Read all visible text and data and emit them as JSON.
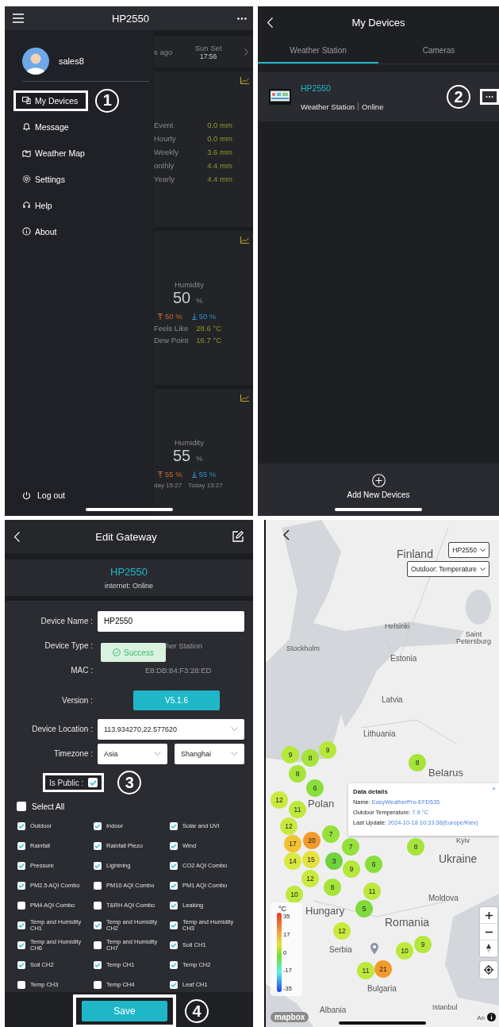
{
  "drawer_screen": {
    "title": "HP2550",
    "user": {
      "name": "sales8"
    },
    "menu": [
      {
        "label": "My Devices",
        "highlighted": true,
        "callout": "1"
      },
      {
        "label": "Message",
        "highlighted": false
      },
      {
        "label": "Weather Map",
        "highlighted": false
      },
      {
        "label": "Settings",
        "highlighted": false
      },
      {
        "label": "Help",
        "highlighted": false
      },
      {
        "label": "About",
        "highlighted": false
      }
    ],
    "logout": "Log out",
    "background": {
      "updated": "s ago",
      "sunset_label": "Sun Set",
      "sunset_time": "17:56",
      "rain": [
        {
          "label": "Event",
          "value": "0.0 mm"
        },
        {
          "label": "Hourly",
          "value": "0.0 mm"
        },
        {
          "label": "Weekly",
          "value": "3.6 mm"
        },
        {
          "label": "onthly",
          "value": "4.4 mm"
        },
        {
          "label": "Yearly",
          "value": "4.4 mm"
        }
      ],
      "humidity_cards": [
        {
          "label": "Humidity",
          "value": "50",
          "unit": "%",
          "high": "50 %",
          "low": "50 %",
          "extras": [
            {
              "label": "Feels Like",
              "value": "28.6 °C"
            },
            {
              "label": "Dew Point",
              "value": "16.7 °C"
            }
          ]
        },
        {
          "label": "Humidity",
          "value": "55",
          "unit": "%",
          "high": "55 %",
          "low": "55 %",
          "times": [
            "day 15:27",
            "Today 15:27"
          ]
        }
      ]
    }
  },
  "devices_screen": {
    "title": "My Devices",
    "tabs": [
      {
        "label": "Weather Station",
        "selected": true
      },
      {
        "label": "Cameras",
        "selected": false
      }
    ],
    "devices": [
      {
        "name": "HP2550",
        "type": "Weather Station",
        "status": "Online",
        "callout": "2"
      }
    ],
    "add_button": "Add New Devices"
  },
  "edit_screen": {
    "title": "Edit Gateway",
    "device": "HP2550",
    "internet": "internet: Online",
    "fields": [
      {
        "kind": "input",
        "label": "Device Name :",
        "value": "HP2550"
      },
      {
        "kind": "text",
        "label": "Device Type :",
        "value": "her Station",
        "toast": "Success"
      },
      {
        "kind": "text",
        "label": "MAC :",
        "value": "E8:DB:84:F3:28:ED"
      },
      {
        "kind": "button",
        "label": "Version :",
        "value": "V5.1.6"
      },
      {
        "kind": "select",
        "label": "Device Location :",
        "value": "113.934270,22.577620"
      },
      {
        "kind": "select_pair",
        "label": "Timezone :",
        "values": [
          "Asia",
          "Shanghai"
        ]
      }
    ],
    "is_public": {
      "label": "Is Public :",
      "checked": true,
      "callout": "3"
    },
    "select_all": {
      "label": "Select All",
      "checked": false
    },
    "sensors": [
      {
        "label": "Outdoor",
        "checked": true
      },
      {
        "label": "Indoor",
        "checked": true
      },
      {
        "label": "Solar and UVI",
        "checked": true
      },
      {
        "label": "Rainfall",
        "checked": true
      },
      {
        "label": "Rainfall Piezo",
        "checked": true
      },
      {
        "label": "Wind",
        "checked": true
      },
      {
        "label": "Pressure",
        "checked": true
      },
      {
        "label": "Lightning",
        "checked": true
      },
      {
        "label": "CO2 AQI Combo",
        "checked": true
      },
      {
        "label": "PM2.5 AQI Combo",
        "checked": true
      },
      {
        "label": "PM10 AQI Combo",
        "checked": false
      },
      {
        "label": "PM1 AQI Combo",
        "checked": true
      },
      {
        "label": "PM4 AQI Combo",
        "checked": false
      },
      {
        "label": "T&RH AQI Combo",
        "checked": false
      },
      {
        "label": "Leaking",
        "checked": true
      },
      {
        "label": "Temp and Humidity CH1",
        "checked": true
      },
      {
        "label": "Temp and Humidity CH2",
        "checked": true
      },
      {
        "label": "Temp and Humidity CH3",
        "checked": true
      },
      {
        "label": "Temp and Humidity CH6",
        "checked": true
      },
      {
        "label": "Temp and Humidity CH7",
        "checked": false
      },
      {
        "label": "Soil CH1",
        "checked": true
      },
      {
        "label": "Soil CH2",
        "checked": true
      },
      {
        "label": "Temp CH1",
        "checked": true
      },
      {
        "label": "Temp CH2",
        "checked": true
      },
      {
        "label": "Temp CH3",
        "checked": false
      },
      {
        "label": "Temp CH4",
        "checked": false
      },
      {
        "label": "Leaf CH1",
        "checked": true
      }
    ],
    "save": {
      "label": "Save",
      "callout": "4"
    }
  },
  "map_screen": {
    "device_select": "HP2550",
    "parameter_select": "Outdoor: Temperature",
    "places": [
      "Finland",
      "Helsinki",
      "Saint Petersburg",
      "Stockholm",
      "Estonia",
      "Latvia",
      "Lithuania",
      "Belarus",
      "Polan",
      "Kyiv",
      "Ukraine",
      "Moldova",
      "Hungary",
      "Romania",
      "Serbia",
      "Bulgaria",
      "Albania",
      "Istanbul"
    ],
    "clusters": [
      {
        "value": "9",
        "color": "#b5e83a"
      },
      {
        "value": "8",
        "color": "#a6e43a"
      },
      {
        "value": "9",
        "color": "#b5e83a"
      },
      {
        "value": "8",
        "color": "#a6e43a"
      },
      {
        "value": "6",
        "color": "#8ade3c"
      },
      {
        "value": "8",
        "color": "#a6e43a"
      },
      {
        "value": "12",
        "color": "#c8ea3e"
      },
      {
        "value": "11",
        "color": "#bde83c"
      },
      {
        "value": "12",
        "color": "#c8ea3e"
      },
      {
        "value": "17",
        "color": "#f2c233"
      },
      {
        "value": "20",
        "color": "#f29a2c"
      },
      {
        "value": "7",
        "color": "#96e03c"
      },
      {
        "value": "7",
        "color": "#96e03c"
      },
      {
        "value": "8",
        "color": "#a6e43a"
      },
      {
        "value": "14",
        "color": "#d8e840"
      },
      {
        "value": "15",
        "color": "#e3e23e"
      },
      {
        "value": "3",
        "color": "#6fd23e"
      },
      {
        "value": "6",
        "color": "#8ade3c"
      },
      {
        "value": "12",
        "color": "#c8ea3e"
      },
      {
        "value": "9",
        "color": "#b5e83a"
      },
      {
        "value": "10",
        "color": "#bde83c"
      },
      {
        "value": "8",
        "color": "#a6e43a"
      },
      {
        "value": "11",
        "color": "#bde83c"
      },
      {
        "value": "5",
        "color": "#7fda3c"
      },
      {
        "value": "12",
        "color": "#c8ea3e"
      },
      {
        "value": "10",
        "color": "#bde83c"
      },
      {
        "value": "9",
        "color": "#b5e83a"
      },
      {
        "value": "11",
        "color": "#bde83c"
      },
      {
        "value": "21",
        "color": "#f29a2c"
      }
    ],
    "popup": {
      "title": "Data details",
      "close": "×",
      "rows": [
        {
          "label": "Name:",
          "value": "EasyWeatherPro-EFD535"
        },
        {
          "label": "Outdoor Temperature:",
          "value": "7.9 °C"
        },
        {
          "label": "Last Update:",
          "value": "2024-10-18 10:33:36(Europe/Kiev)"
        }
      ]
    },
    "legend": {
      "unit": "°C",
      "ticks": [
        "35",
        "17",
        "0",
        "-17",
        "-35"
      ]
    },
    "attribution": "mapbox",
    "corner_text": "An"
  }
}
